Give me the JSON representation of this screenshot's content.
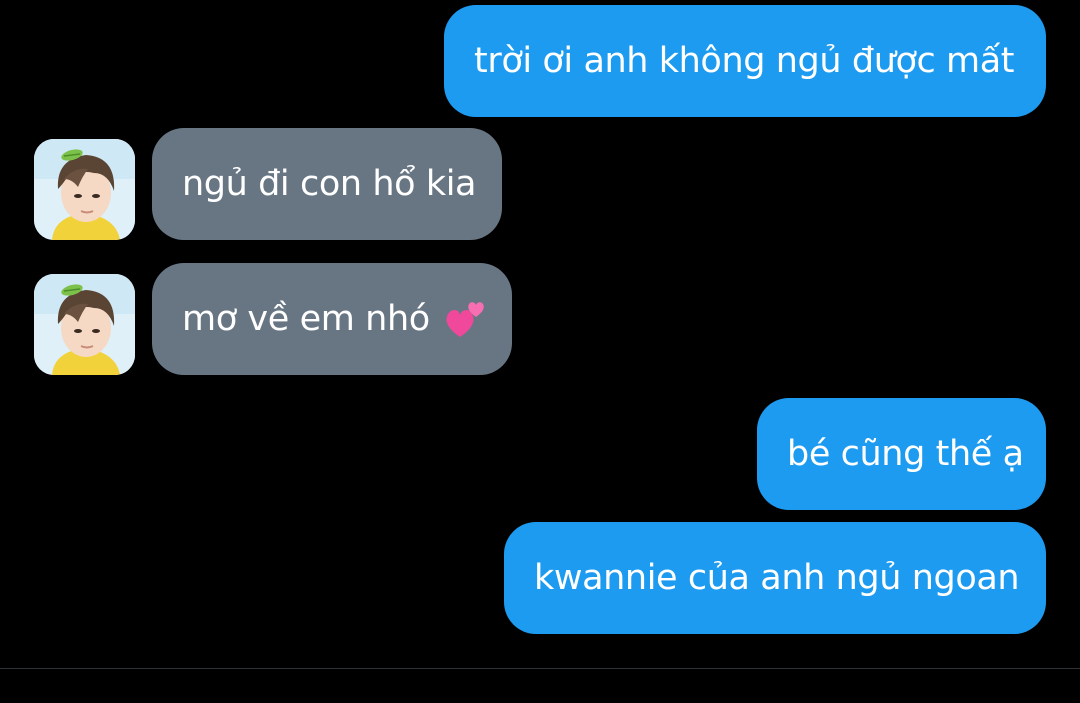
{
  "messages": [
    {
      "side": "sent",
      "text": "trời ơi anh không ngủ được mất"
    },
    {
      "side": "received",
      "text": "ngủ đi con hổ kia",
      "avatar_icon": "contact-avatar"
    },
    {
      "side": "received",
      "text": "mơ về em nhó",
      "emoji_icon": "two-hearts-emoji",
      "avatar_icon": "contact-avatar"
    },
    {
      "side": "sent",
      "text": "bé cũng thế ạ"
    },
    {
      "side": "sent",
      "text": "kwannie của anh ngủ ngoan"
    }
  ],
  "colors": {
    "background": "#000000",
    "sent_bubble": "#1d9bf0",
    "received_bubble": "#687684",
    "text": "#ffffff",
    "divider": "#2f3336"
  }
}
